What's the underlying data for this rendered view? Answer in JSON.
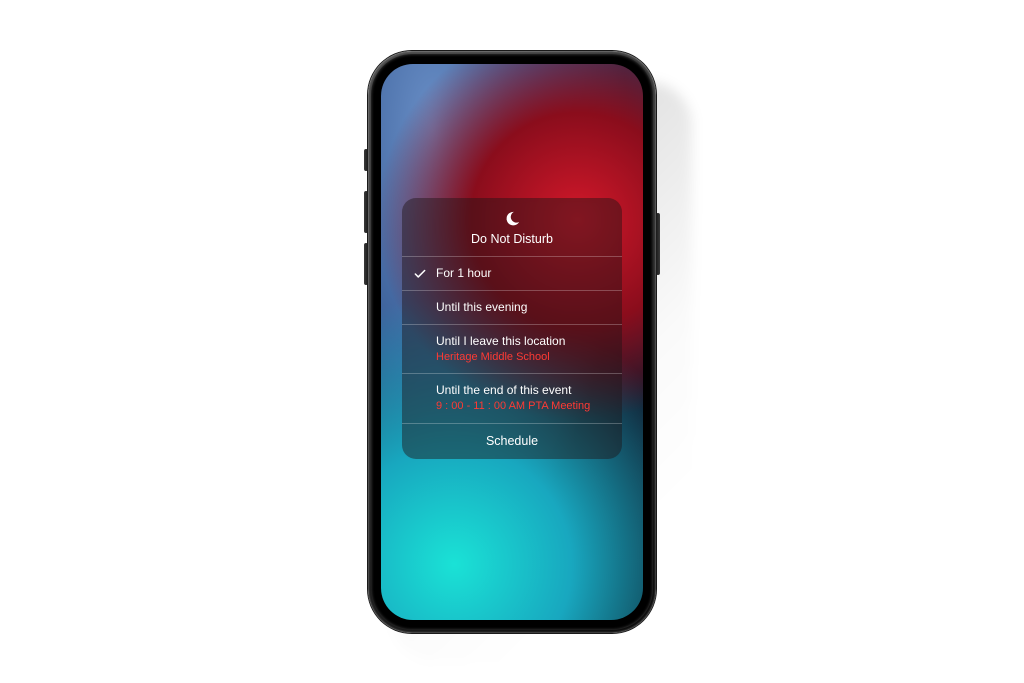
{
  "panel": {
    "title": "Do Not Disturb",
    "icon": "moon-icon",
    "options": [
      {
        "label": "For 1 hour",
        "selected": true
      },
      {
        "label": "Until this evening",
        "selected": false
      },
      {
        "label": "Until I leave this location",
        "sub": "Heritage Middle School",
        "selected": false
      },
      {
        "label": "Until the end of this event",
        "sub": "9 : 00 - 11 : 00 AM PTA Meeting",
        "selected": false
      }
    ],
    "footer": "Schedule"
  }
}
